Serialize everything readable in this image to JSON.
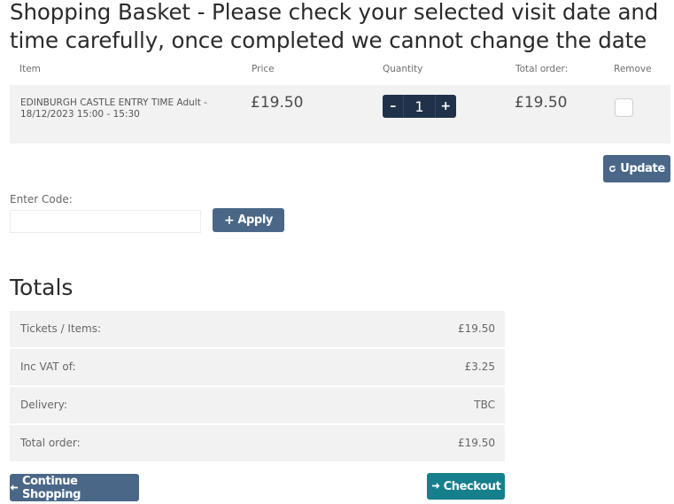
{
  "page_heading": "Shopping Basket - Please check your selected visit date and time carefully, once completed we cannot change the date",
  "basket": {
    "columns": {
      "item": "Item",
      "price": "Price",
      "quantity": "Quantity",
      "total": "Total order:",
      "remove": "Remove"
    },
    "row": {
      "item_name": "EDINBURGH CASTLE ENTRY TIME Adult - 18/12/2023 15:00 - 15:30",
      "price": "£19.50",
      "quantity": "1",
      "qty_minus": "–",
      "qty_plus": "+",
      "total": "£19.50",
      "remove_checked": false
    },
    "update_label": "Update",
    "update_icon": "refresh-icon"
  },
  "code": {
    "label": "Enter Code:",
    "value": "",
    "placeholder": "",
    "apply_label": "Apply",
    "apply_icon": "plus-icon"
  },
  "totals": {
    "title": "Totals",
    "rows": [
      {
        "label": "Tickets / Items:",
        "value": "£19.50"
      },
      {
        "label": "Inc VAT of:",
        "value": "£3.25"
      },
      {
        "label": "Delivery:",
        "value": "TBC"
      },
      {
        "label": "Total order:",
        "value": "£19.50"
      }
    ]
  },
  "actions": {
    "continue_label": "Continue Shopping",
    "continue_icon": "arrow-left-icon",
    "checkout_label": "Checkout",
    "checkout_icon": "arrow-right-icon"
  },
  "colors": {
    "primary_button": "#4a6788",
    "checkout_button": "#167f8c",
    "quantity_stepper": "#1f3249",
    "row_background": "#f2f2f2"
  }
}
